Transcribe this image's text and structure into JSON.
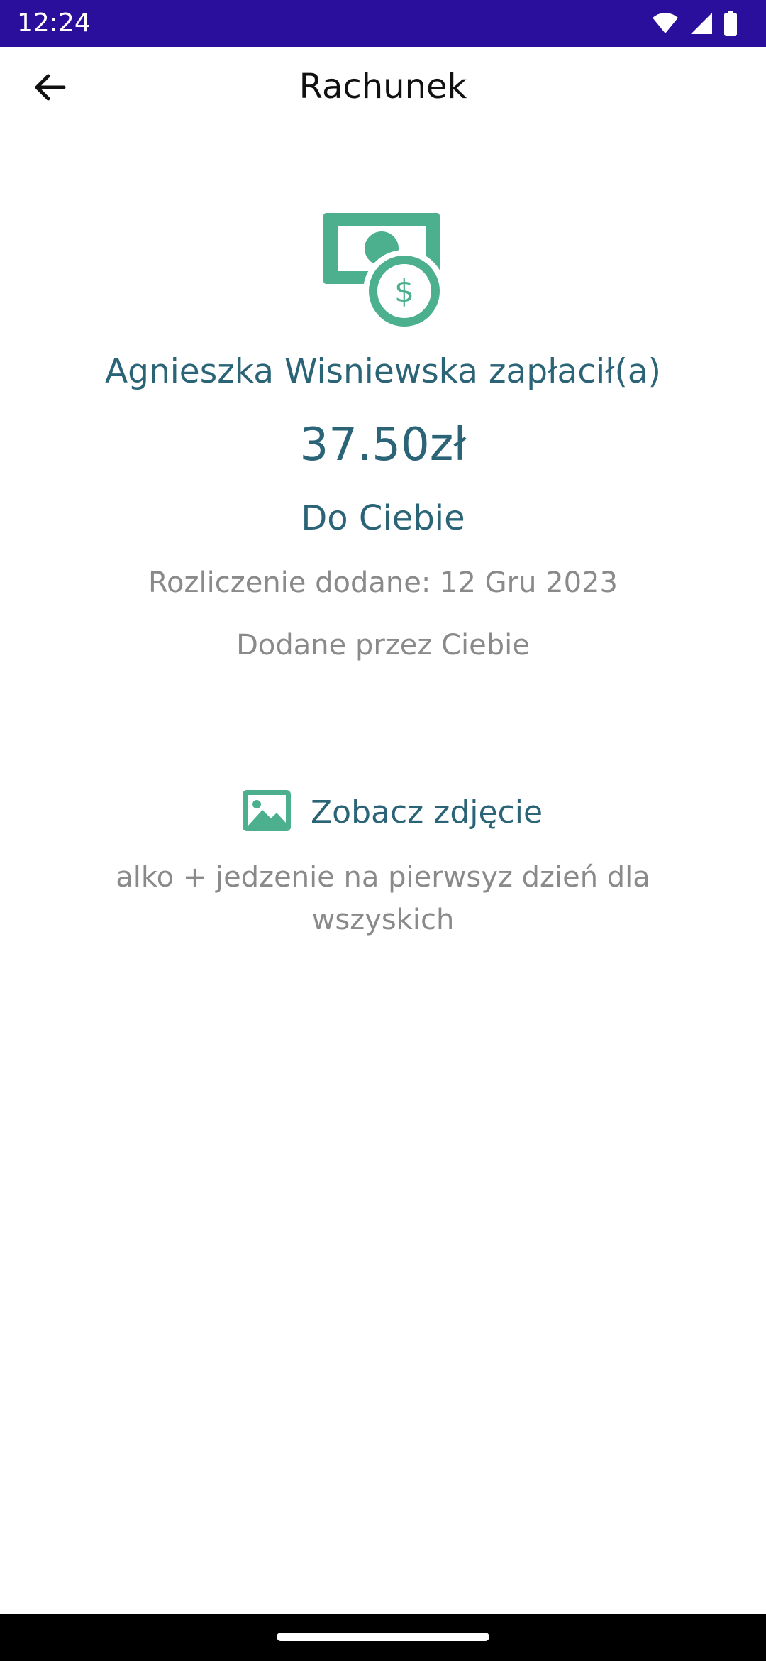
{
  "status_bar": {
    "time": "12:24",
    "icons": [
      "wifi-icon",
      "signal-icon",
      "battery-icon"
    ]
  },
  "app_bar": {
    "back_icon": "arrow-left-icon",
    "title": "Rachunek"
  },
  "payment": {
    "icon": "money-icon",
    "payer_text": "Agnieszka Wisniewska zapłacił(a)",
    "amount": "37.50zł",
    "recipient": "Do Ciebie",
    "added_date": "Rozliczenie dodane: 12 Gru 2023",
    "added_by": "Dodane przez Ciebie"
  },
  "photo": {
    "icon": "image-icon",
    "label": "Zobacz zdjęcie"
  },
  "note": "alko + jedzenie na pierwsyz dzień dla wszyskich",
  "colors": {
    "status_bar": "#2a0e9c",
    "accent": "#2a6476",
    "icon_green": "#4caf8d",
    "secondary_text": "#8a8a8a"
  }
}
